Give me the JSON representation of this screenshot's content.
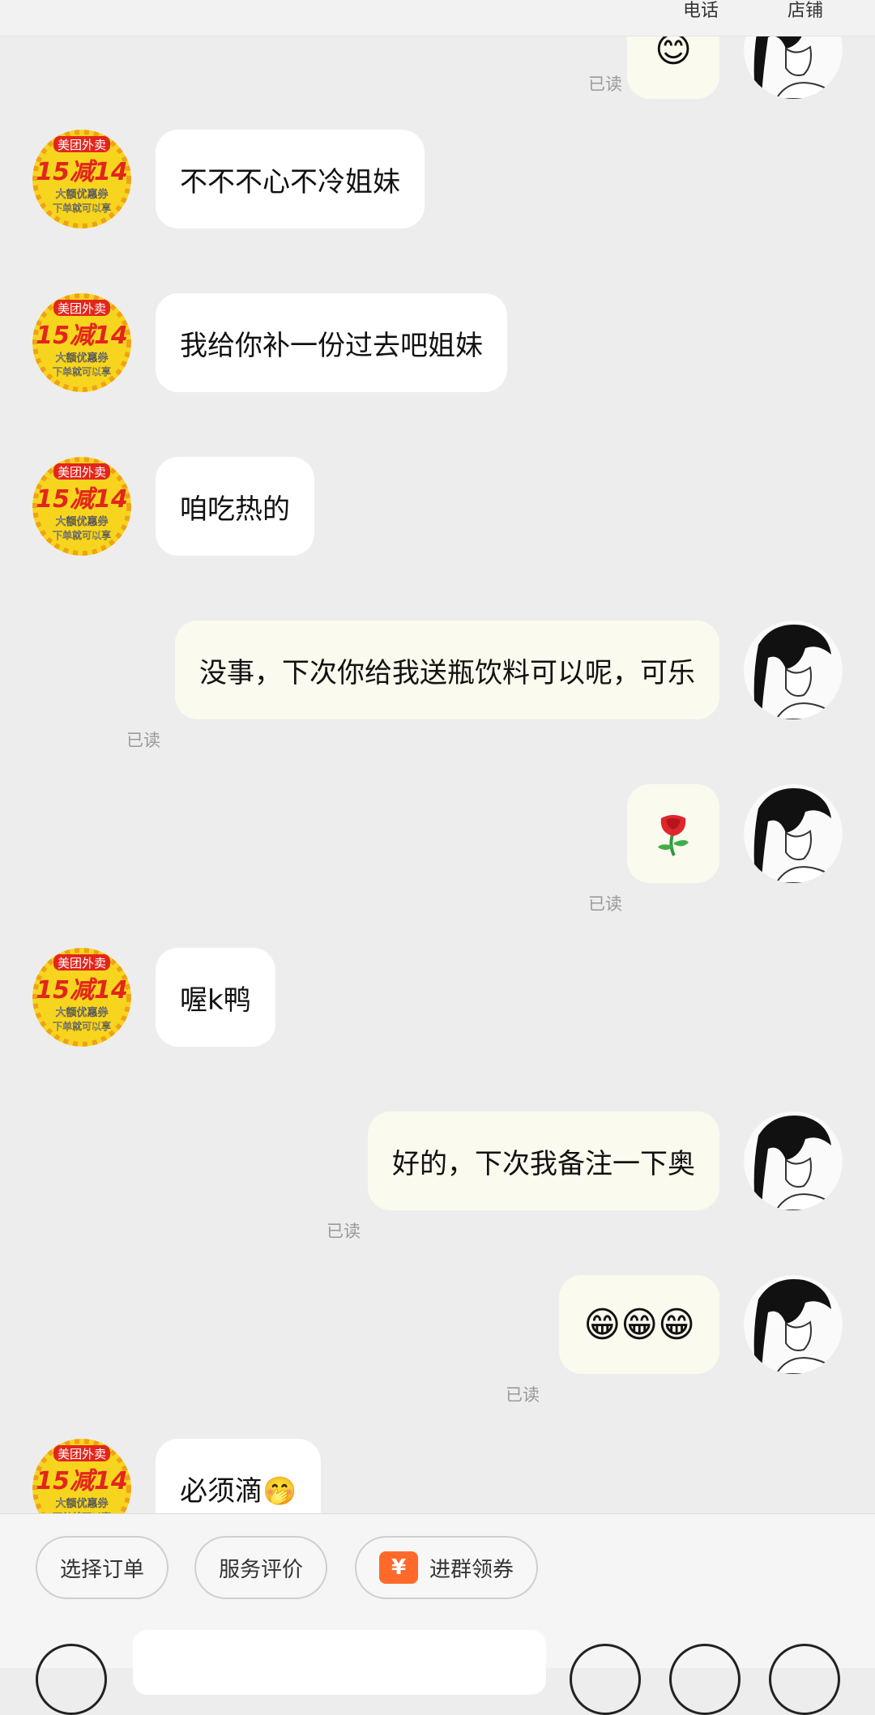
{
  "header": {
    "phone_label": "电话",
    "shop_label": "店铺"
  },
  "messages": [
    {
      "side": "right",
      "kind": "emoji",
      "content": "😊",
      "read": "已读"
    },
    {
      "side": "left",
      "kind": "text",
      "content": "不不不心不冷姐妹"
    },
    {
      "side": "left",
      "kind": "text",
      "content": "我给你补一份过去吧姐妹"
    },
    {
      "side": "left",
      "kind": "text",
      "content": "咱吃热的"
    },
    {
      "side": "right",
      "kind": "text",
      "content": "没事，下次你给我送瓶饮料可以呢，可乐",
      "read": "已读"
    },
    {
      "side": "right",
      "kind": "emoji",
      "content": "🌹",
      "read": "已读"
    },
    {
      "side": "left",
      "kind": "text",
      "content": "喔k鸭"
    },
    {
      "side": "right",
      "kind": "text",
      "content": "好的，下次我备注一下奥",
      "read": "已读"
    },
    {
      "side": "right",
      "kind": "text",
      "content": "😁😁😁",
      "read": "已读"
    },
    {
      "side": "left",
      "kind": "text",
      "content": "必须滴🤭"
    }
  ],
  "shop_avatar": {
    "line1": "美团外卖",
    "line2": "15减14",
    "line3": "大额优惠券",
    "line4": "下单就可以享"
  },
  "bottom_bar": {
    "select_order": "选择订单",
    "service_review": "服务评价",
    "coupon_icon": "¥",
    "join_group": "进群领券"
  },
  "colors": {
    "background": "#ededed",
    "left_bubble": "#ffffff",
    "right_bubble": "#fbfaee",
    "avatar_yellow": "#f7d51e",
    "avatar_red": "#e2261c",
    "coupon_orange": "#ff6a2b"
  },
  "icons": [
    "voice-icon",
    "emoji-icon",
    "image-icon",
    "add-icon",
    "rose-icon"
  ]
}
